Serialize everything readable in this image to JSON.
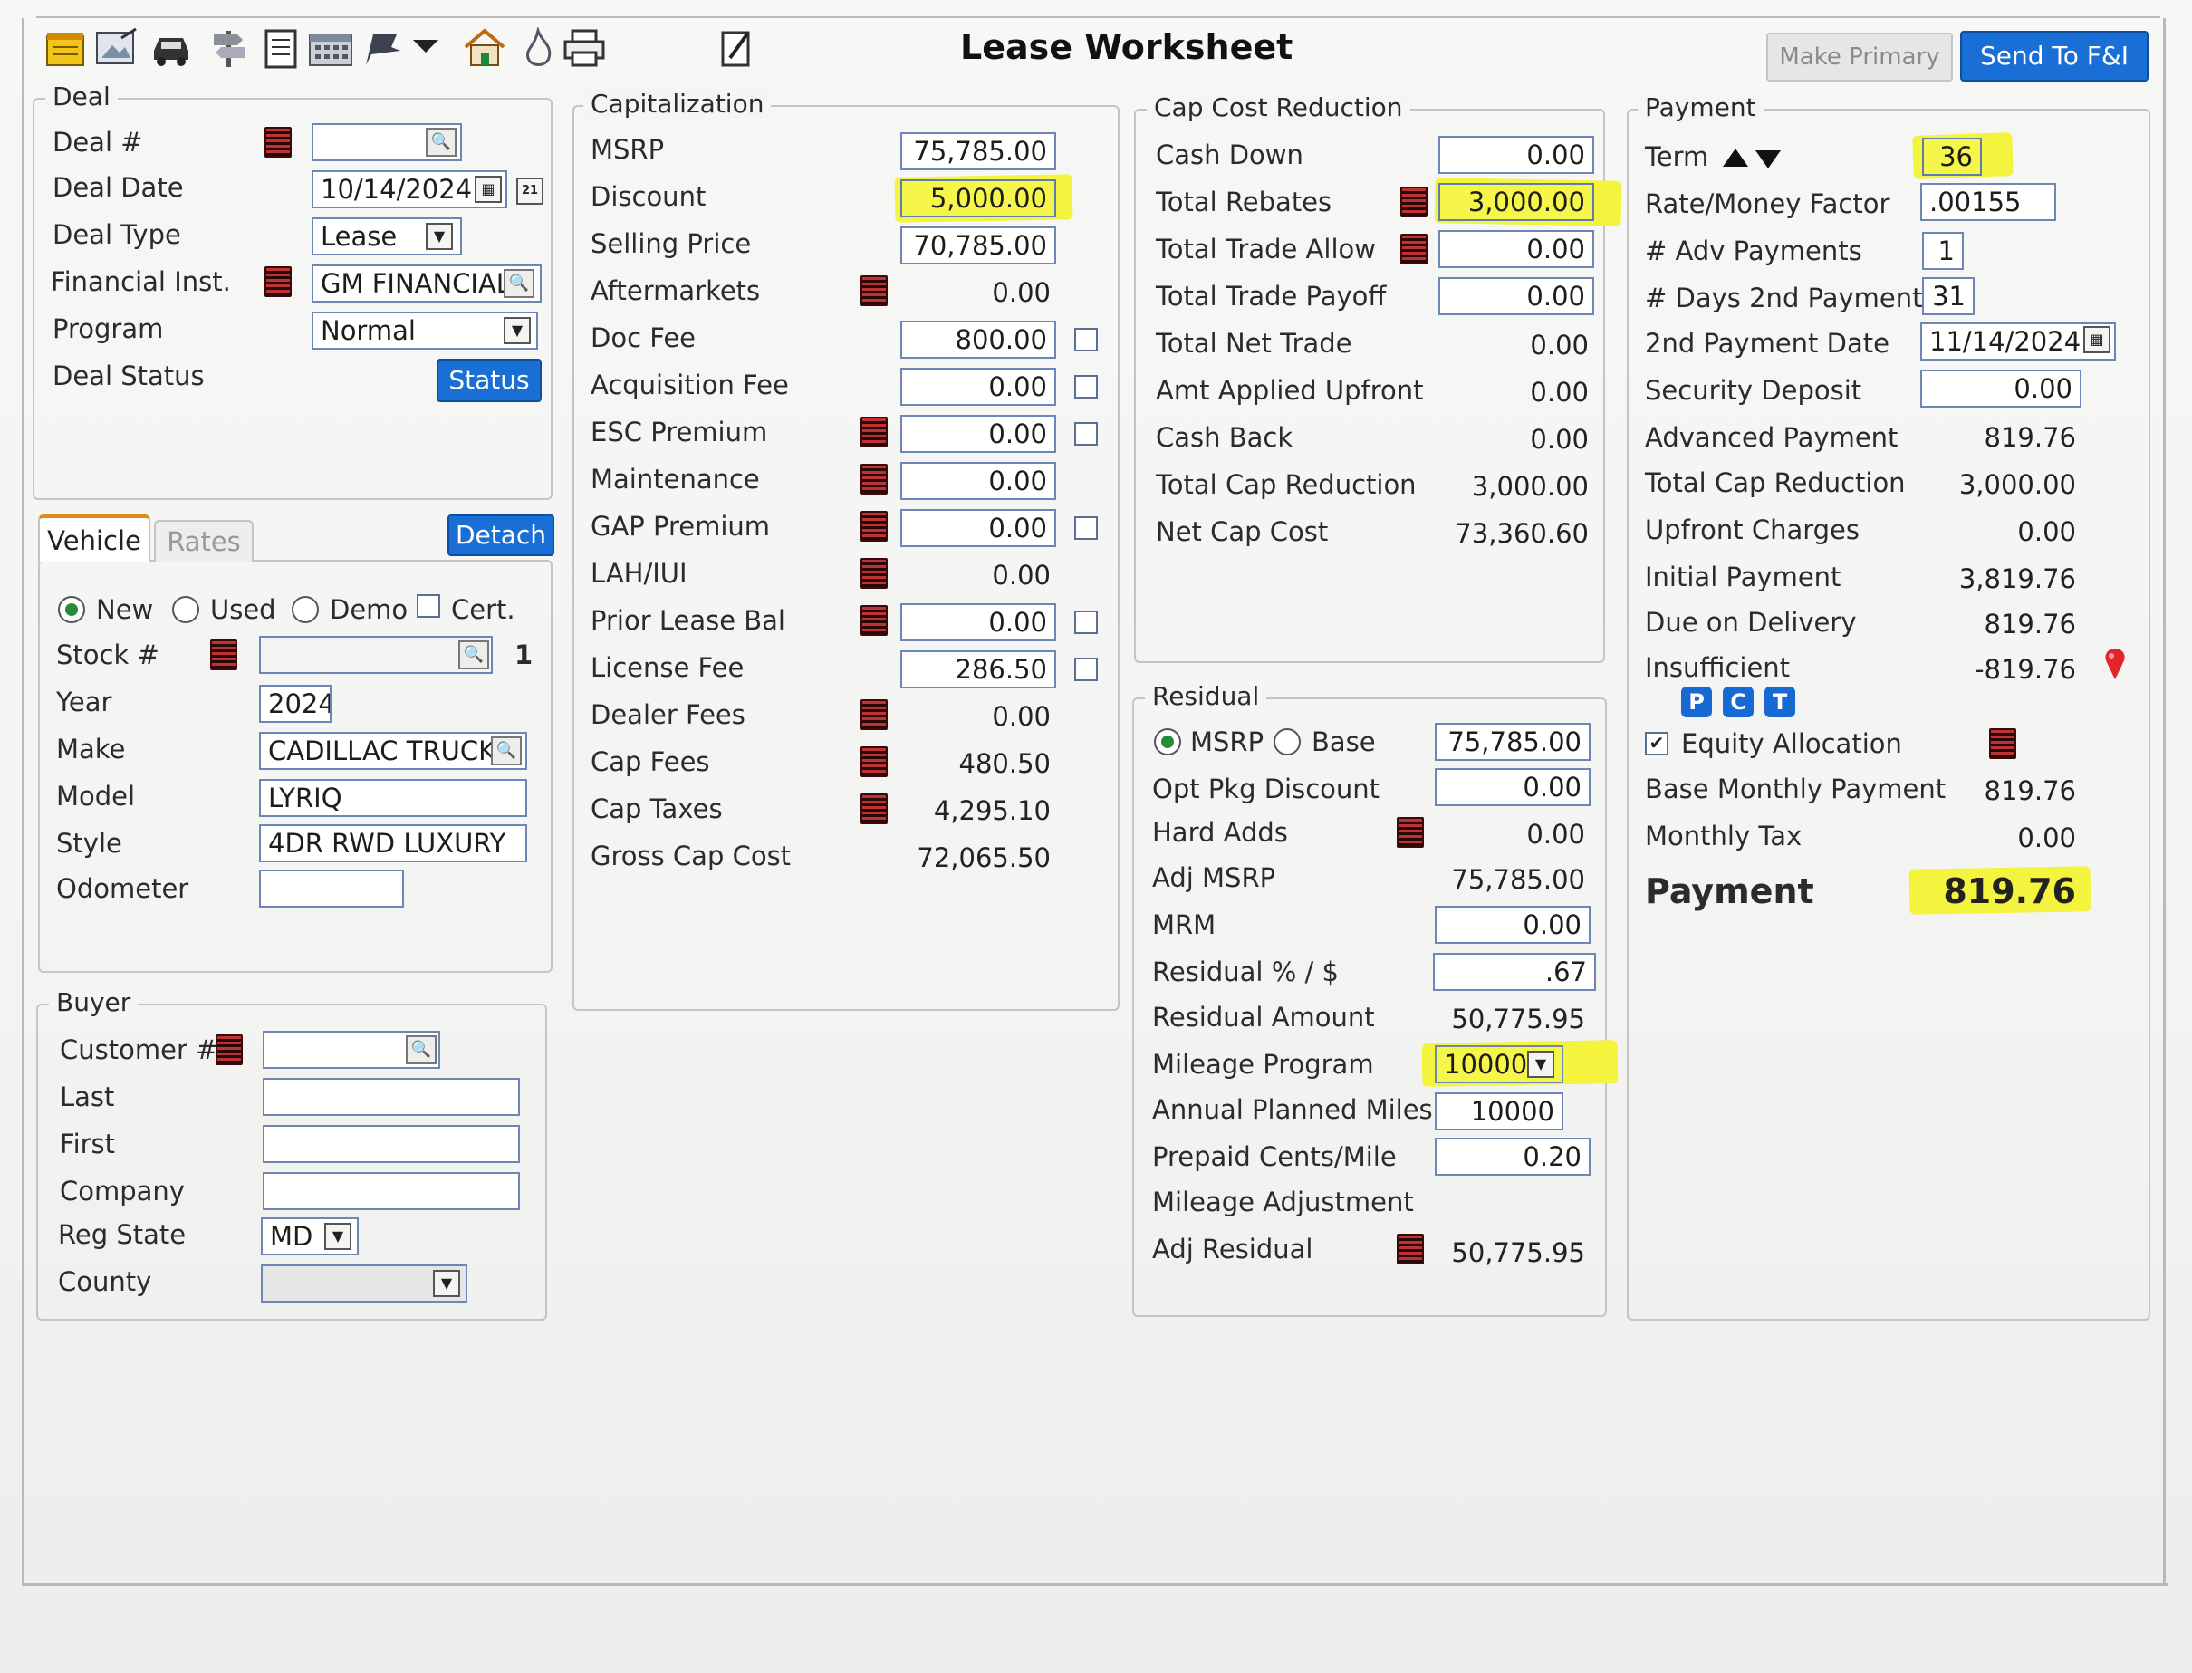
{
  "title": "Lease Worksheet",
  "toolbar": {
    "icons": [
      "notepad-icon",
      "edit-image-icon",
      "vehicle-icon",
      "direction-sign-icon",
      "document-icon",
      "calculator-icon",
      "flag-icon",
      "dropdown-arrow-icon",
      "home-icon",
      "flame-icon",
      "print-icon",
      "pencil-icon"
    ],
    "make_primary": "Make Primary",
    "send_fi": "Send To F&I"
  },
  "deal": {
    "legend": "Deal",
    "deal_no_label": "Deal #",
    "deal_no": "",
    "deal_date_label": "Deal Date",
    "deal_date": "10/14/2024",
    "deal_type_label": "Deal Type",
    "deal_type": "Lease",
    "fin_inst_label": "Financial Inst.",
    "fin_inst": "GM FINANCIAL/",
    "program_label": "Program",
    "program": "Normal",
    "status_label": "Deal Status",
    "status_button": "Status"
  },
  "vehicle": {
    "tab_vehicle": "Vehicle",
    "tab_rates": "Rates",
    "detach": "Detach",
    "new": "New",
    "used": "Used",
    "demo": "Demo",
    "cert": "Cert.",
    "stock_label": "Stock #",
    "stock": "",
    "stock_count": "1",
    "year_label": "Year",
    "year": "2024",
    "make_label": "Make",
    "make": "CADILLAC TRUCK",
    "model_label": "Model",
    "model": "LYRIQ",
    "style_label": "Style",
    "style": "4DR RWD LUXURY",
    "odometer_label": "Odometer",
    "odometer": ""
  },
  "buyer": {
    "legend": "Buyer",
    "customer_label": "Customer #",
    "last_label": "Last",
    "first_label": "First",
    "company_label": "Company",
    "reg_state_label": "Reg State",
    "reg_state": "MD",
    "county_label": "County"
  },
  "cap": {
    "legend": "Capitalization",
    "msrp_label": "MSRP",
    "msrp": "75,785.00",
    "discount_label": "Discount",
    "discount": "5,000.00",
    "selling_label": "Selling Price",
    "selling": "70,785.00",
    "aftermarkets_label": "Aftermarkets",
    "aftermarkets": "0.00",
    "doc_fee_label": "Doc Fee",
    "doc_fee": "800.00",
    "acq_label": "Acquisition Fee",
    "acq": "0.00",
    "esc_label": "ESC Premium",
    "esc": "0.00",
    "maint_label": "Maintenance",
    "maint": "0.00",
    "gap_label": "GAP Premium",
    "gap": "0.00",
    "lah_label": "LAH/IUI",
    "lah": "0.00",
    "prior_label": "Prior Lease Bal",
    "prior": "0.00",
    "license_label": "License Fee",
    "license": "286.50",
    "dealer_label": "Dealer Fees",
    "dealer": "0.00",
    "capfees_label": "Cap Fees",
    "capfees": "480.50",
    "captaxes_label": "Cap Taxes",
    "captaxes": "4,295.10",
    "gross_label": "Gross Cap Cost",
    "gross": "72,065.50"
  },
  "ccr": {
    "legend": "Cap Cost Reduction",
    "cash_down_label": "Cash Down",
    "cash_down": "0.00",
    "rebates_label": "Total Rebates",
    "rebates": "3,000.00",
    "trade_allow_label": "Total Trade Allow",
    "trade_allow": "0.00",
    "trade_payoff_label": "Total Trade Payoff",
    "trade_payoff": "0.00",
    "net_trade_label": "Total Net Trade",
    "net_trade": "0.00",
    "amt_upfront_label": "Amt Applied Upfront",
    "amt_upfront": "0.00",
    "cash_back_label": "Cash Back",
    "cash_back": "0.00",
    "total_ccr_label": "Total Cap Reduction",
    "total_ccr": "3,000.00",
    "net_cap_label": "Net Cap Cost",
    "net_cap": "73,360.60"
  },
  "residual": {
    "legend": "Residual",
    "msrp_opt": "MSRP",
    "base_opt": "Base",
    "value": "75,785.00",
    "opt_pkg_label": "Opt Pkg Discount",
    "opt_pkg": "0.00",
    "hard_adds_label": "Hard Adds",
    "hard_adds": "0.00",
    "adj_msrp_label": "Adj MSRP",
    "adj_msrp": "75,785.00",
    "mrm_label": "MRM",
    "mrm": "0.00",
    "pct_label": "Residual % / $",
    "pct": ".67",
    "amount_label": "Residual Amount",
    "amount": "50,775.95",
    "mileage_label": "Mileage Program",
    "mileage": "10000",
    "annual_label": "Annual Planned Miles",
    "annual": "10000",
    "prepaid_label": "Prepaid Cents/Mile",
    "prepaid": "0.20",
    "mileage_adj_label": "Mileage Adjustment",
    "adj_res_label": "Adj Residual",
    "adj_res": "50,775.95"
  },
  "payment": {
    "legend": "Payment",
    "term_label": "Term",
    "term": "36",
    "rate_label": "Rate/Money Factor",
    "rate": ".00155",
    "adv_label": "# Adv Payments",
    "adv": "1",
    "days_label": "# Days 2nd Payment",
    "days": "31",
    "date2_label": "2nd Payment Date",
    "date2": "11/14/2024",
    "security_label": "Security Deposit",
    "security": "0.00",
    "advanced_label": "Advanced Payment",
    "advanced": "819.76",
    "tcr_label": "Total Cap Reduction",
    "tcr": "3,000.00",
    "upfront_label": "Upfront Charges",
    "upfront": "0.00",
    "initial_label": "Initial Payment",
    "initial": "3,819.76",
    "due_label": "Due on Delivery",
    "due": "819.76",
    "insuff_label": "Insufficient",
    "insuff": "-819.76",
    "p": "P",
    "c": "C",
    "t": "T",
    "equity_label": "Equity Allocation",
    "base_label": "Base Monthly Payment",
    "base": "819.76",
    "tax_label": "Monthly Tax",
    "tax": "0.00",
    "payment_label": "Payment",
    "payment": "819.76"
  }
}
